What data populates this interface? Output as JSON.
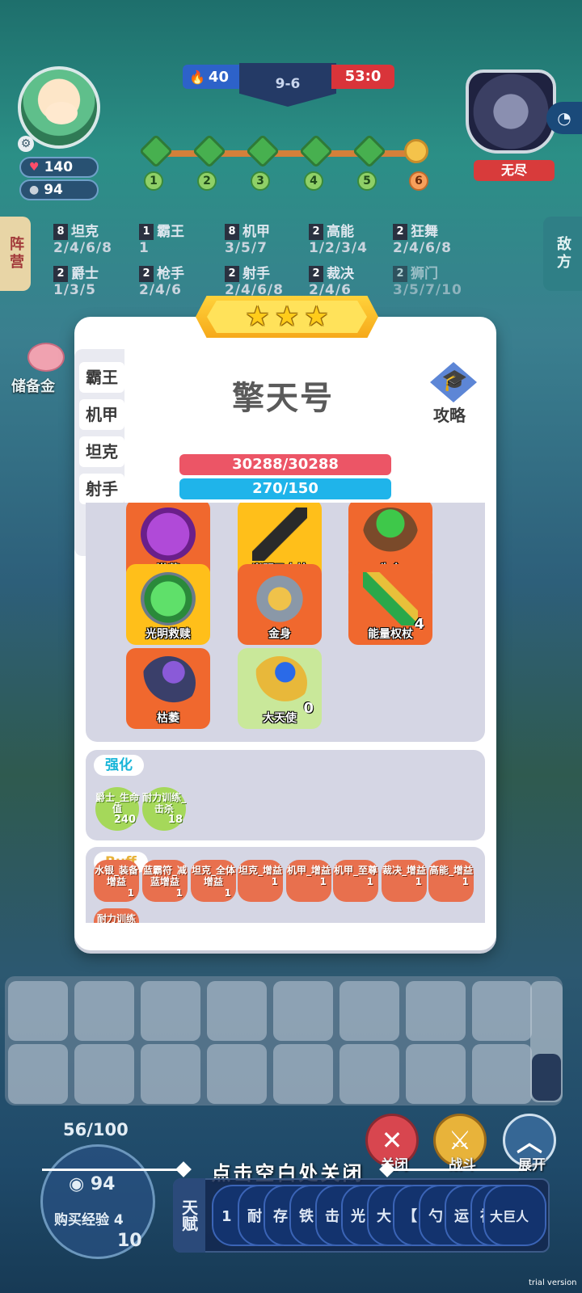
{
  "hud": {
    "hp": "140",
    "coins": "94",
    "score_left": "40",
    "round": "9-6",
    "score_right": "53:0",
    "enemy_label": "无尽",
    "rounds": [
      "1",
      "2",
      "3",
      "4",
      "5",
      "6"
    ],
    "left_tab": "阵营",
    "right_tab": "敌方",
    "piggy_label": "储备金"
  },
  "synergies": [
    {
      "count": "8",
      "name": "坦克",
      "levels": "2/4/6/8"
    },
    {
      "count": "1",
      "name": "霸王",
      "levels": "1"
    },
    {
      "count": "8",
      "name": "机甲",
      "levels": "3/5/7"
    },
    {
      "count": "2",
      "name": "高能",
      "levels": "1/2/3/4"
    },
    {
      "count": "2",
      "name": "狂舞",
      "levels": "2/4/6/8"
    },
    {
      "count": "2",
      "name": "爵士",
      "levels": "1/3/5"
    },
    {
      "count": "2",
      "name": "枪手",
      "levels": "2/4/6"
    },
    {
      "count": "2",
      "name": "射手",
      "levels": "2/4/6/8"
    },
    {
      "count": "2",
      "name": "裁决",
      "levels": "2/4/6"
    },
    {
      "count": "2",
      "name": "狮门",
      "levels": "3/5/7/10"
    }
  ],
  "modal": {
    "stars": [
      "★",
      "★",
      "★"
    ],
    "trait_tabs": [
      "霸王",
      "机甲",
      "坦克",
      "射手"
    ],
    "unit_name": "擎天号",
    "guide_label": "攻略",
    "hp_text": "30288/30288",
    "mp_text": "270/150",
    "items": [
      {
        "label": "激荡",
        "badge": ""
      },
      {
        "label": "光明吸血枪",
        "badge": ""
      },
      {
        "label": "生命",
        "badge": ""
      },
      {
        "label": "光明救赎",
        "badge": ""
      },
      {
        "label": "金身",
        "badge": ""
      },
      {
        "label": "能量权杖",
        "badge": "4"
      },
      {
        "label": "枯萎",
        "badge": ""
      },
      {
        "label": "大天使",
        "badge": "0"
      }
    ],
    "enhance_title": "强化",
    "enhancements": [
      {
        "label": "爵士_生命值",
        "value": "240"
      },
      {
        "label": "耐力训练_击杀",
        "value": "18"
      }
    ],
    "buff_title": "Buff",
    "buffs": [
      {
        "label": "水银_装备增益",
        "value": "1"
      },
      {
        "label": "蓝霸符_减蓝增益",
        "value": "1"
      },
      {
        "label": "坦克_全体增益",
        "value": "1"
      },
      {
        "label": "坦克_增益",
        "value": "1"
      },
      {
        "label": "机甲_增益",
        "value": "1"
      },
      {
        "label": "机甲_至尊",
        "value": "1"
      },
      {
        "label": "裁决_增益",
        "value": "1"
      },
      {
        "label": "高能_增益",
        "value": "1"
      }
    ],
    "buff_more": "耐力训练"
  },
  "bottom": {
    "exp": "56/100",
    "coins": "94",
    "buy_label": "购买经验 4",
    "level": "10",
    "close_label": "关闭",
    "fight_label": "战斗",
    "expand_label": "展开",
    "hint": "点击空白处关闭",
    "talent_tab": "天赋",
    "talents": [
      "1",
      "耐",
      "存",
      "铁",
      "击",
      "光",
      "大",
      "【",
      "勺",
      "运",
      "神",
      "大巨人"
    ],
    "trial": "trial version"
  },
  "colors": {
    "hp_bar": "#ec5566",
    "mp_bar": "#1fb4ea",
    "accent_title": "#18b5d8",
    "item_orange": "#f0682e",
    "item_yellow": "#ffbf1a"
  }
}
